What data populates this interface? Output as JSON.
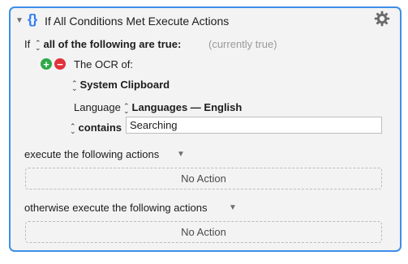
{
  "header": {
    "title": "If All Conditions Met Execute Actions",
    "braces": "{}",
    "collapse_icon": "disclosure-triangle-down",
    "settings_icon": "gear"
  },
  "condition": {
    "if_label": "If",
    "match_mode": "all of the following are true:",
    "status": "(currently true)",
    "ocr_label": "The OCR of:",
    "source": "System Clipboard",
    "language_label": "Language",
    "language_value": "Languages — English",
    "operator": "contains",
    "value": "Searching"
  },
  "then_section": {
    "label": "execute the following actions",
    "empty_label": "No Action"
  },
  "else_section": {
    "label": "otherwise execute the following actions",
    "empty_label": "No Action"
  },
  "colors": {
    "accent_border": "#3d8ee8",
    "braces": "#2f7cf6",
    "add_button": "#2ea84a",
    "remove_button": "#e0323b"
  }
}
